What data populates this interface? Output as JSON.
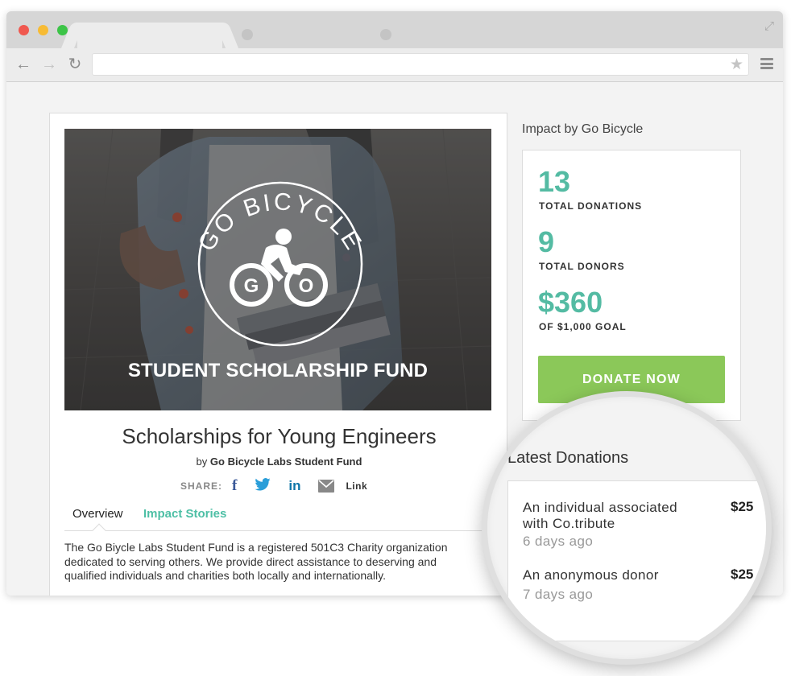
{
  "browser": {
    "url": "",
    "controls": {
      "back": "back-arrow-icon",
      "forward": "forward-arrow-icon",
      "reload": "reload-icon",
      "bookmark": "star-icon",
      "menu": "hamburger-menu-icon"
    }
  },
  "campaign": {
    "hero_logo_text": "GO BICYCLE",
    "hero_logo_inner": {
      "left": "G",
      "right": "O"
    },
    "hero_title": "STUDENT SCHOLARSHIP FUND",
    "title": "Scholarships for Young Engineers",
    "byline_prefix": "by",
    "byline_org": "Go Bicycle Labs Student Fund",
    "share": {
      "label": "SHARE:",
      "facebook": "f",
      "twitter": "twitter-icon",
      "linkedin": "in",
      "link_label": "Link"
    },
    "tabs": [
      {
        "label": "Overview",
        "active": true
      },
      {
        "label": "Impact Stories",
        "active": false
      }
    ],
    "description": "The Go Biycle Labs Student Fund is a registered 501C3 Charity organization dedicated to serving others. We provide direct assistance to deserving and qualified individuals and charities both locally and internationally."
  },
  "impact": {
    "heading": "Impact by Go Bicycle",
    "stats": [
      {
        "value": "13",
        "label": "TOTAL DONATIONS"
      },
      {
        "value": "9",
        "label": "TOTAL DONORS"
      },
      {
        "value": "$360",
        "label": "OF $1,000 GOAL"
      }
    ],
    "donate_label": "DONATE NOW"
  },
  "latest": {
    "heading": "Latest Donations",
    "donations": [
      {
        "name_line1": "An individual associated",
        "name_line2": "with Co.tribute",
        "time": "6 days ago",
        "amount": "$25"
      },
      {
        "name_line1": "An anonymous donor",
        "time": "7 days ago",
        "amount": "$25"
      }
    ]
  },
  "colors": {
    "accent_teal": "#54bba3",
    "donate_green": "#8bc859",
    "facebook": "#3b5998",
    "twitter": "#2a9ed9",
    "linkedin": "#0e76a8"
  }
}
